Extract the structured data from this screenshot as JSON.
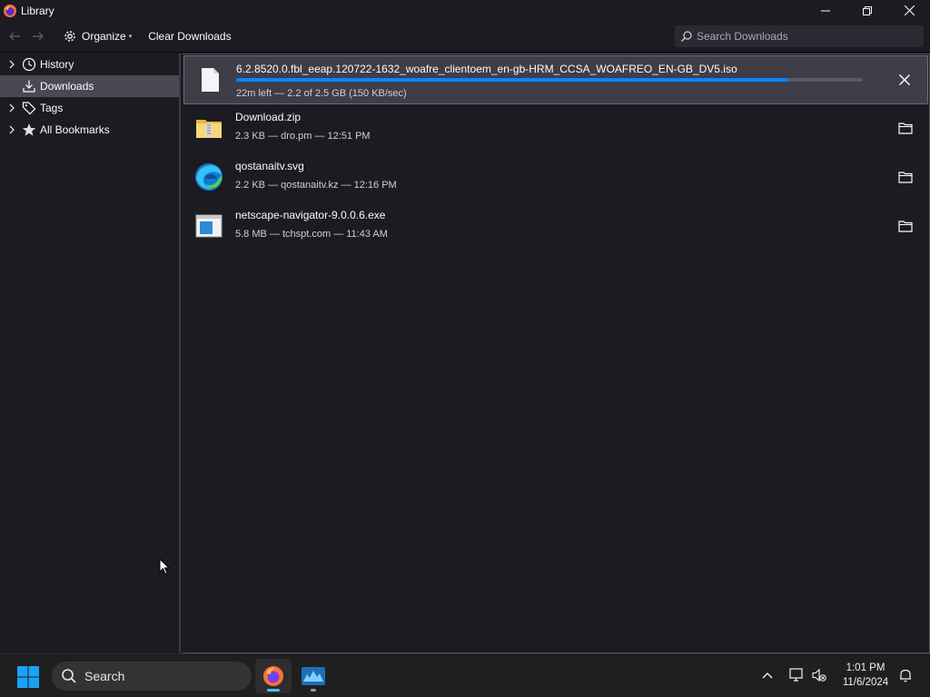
{
  "window": {
    "title": "Library",
    "controls": [
      "minimize-icon",
      "restore-icon",
      "close-icon"
    ]
  },
  "toolbar": {
    "back_icon": "arrow-left-icon",
    "forward_icon": "arrow-right-icon",
    "organize_label": "Organize",
    "clear_label": "Clear Downloads",
    "search_placeholder": "Search Downloads"
  },
  "sidebar": {
    "items": [
      {
        "label": "History",
        "icon": "clock-icon",
        "expandable": true,
        "selected": false
      },
      {
        "label": "Downloads",
        "icon": "download-icon",
        "expandable": false,
        "selected": true
      },
      {
        "label": "Tags",
        "icon": "tag-icon",
        "expandable": true,
        "selected": false
      },
      {
        "label": "All Bookmarks",
        "icon": "star-icon",
        "expandable": true,
        "selected": false
      }
    ]
  },
  "downloads": [
    {
      "name": "6.2.8520.0.fbl_eeap.120722-1632_woafre_clientoem_en-gb-HRM_CCSA_WOAFREO_EN-GB_DV5.iso",
      "status": "22m left — 2.2 of 2.5 GB (150 KB/sec)",
      "progress": 0.88,
      "icon": "file-icon",
      "action": "cancel-icon",
      "active": true
    },
    {
      "name": "Download.zip",
      "status": "2.3 KB — dro.pm — 12:51 PM",
      "icon": "zip-folder-icon",
      "action": "folder-icon"
    },
    {
      "name": "qostanaitv.svg",
      "status": "2.2 KB — qostanaitv.kz — 12:16 PM",
      "icon": "edge-icon",
      "action": "folder-icon"
    },
    {
      "name": "netscape-navigator-9.0.0.6.exe",
      "status": "5.8 MB — tchspt.com — 11:43 AM",
      "icon": "exe-window-icon",
      "action": "folder-icon"
    }
  ],
  "taskbar": {
    "search_label": "Search",
    "time": "1:01 PM",
    "date": "11/6/2024",
    "apps": [
      "firefox-icon",
      "media-app-icon"
    ],
    "tray": [
      "chevron-up-icon",
      "network-icon",
      "volume-muted-icon",
      "notification-bell-icon"
    ]
  }
}
